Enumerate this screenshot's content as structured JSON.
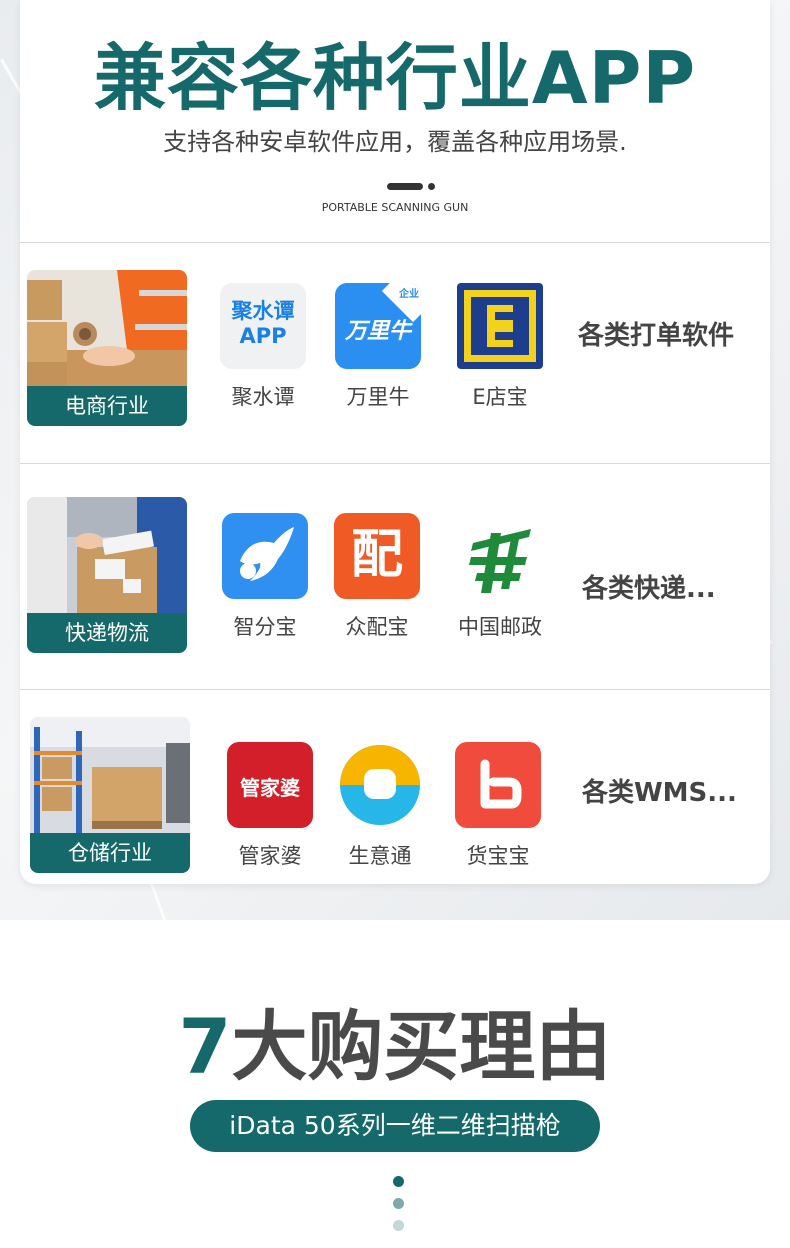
{
  "hero": {
    "title": "兼容各种行业APP",
    "subtitle": "支持各种安卓软件应用，覆盖各种应用场景.",
    "caption": "PORTABLE SCANNING GUN"
  },
  "rows": [
    {
      "industry": "电商行业",
      "apps": [
        {
          "name": "聚水谭",
          "icon": "jushuitan-app-icon",
          "icon_text": "聚水谭\nAPP"
        },
        {
          "name": "万里牛",
          "icon": "wanliniu-app-icon",
          "icon_text": "万里牛",
          "corner": "企业"
        },
        {
          "name": "E店宝",
          "icon": "edianbao-app-icon",
          "icon_text": "E"
        }
      ],
      "tag": "各类打单软件"
    },
    {
      "industry": "快递物流",
      "apps": [
        {
          "name": "智分宝",
          "icon": "zhifenbao-app-icon"
        },
        {
          "name": "众配宝",
          "icon": "zhongpeibao-app-icon",
          "icon_text": "配"
        },
        {
          "name": "中国邮政",
          "icon": "china-post-app-icon"
        }
      ],
      "tag": "各类快递..."
    },
    {
      "industry": "仓储行业",
      "apps": [
        {
          "name": "管家婆",
          "icon": "guanjiapo-app-icon",
          "icon_text": "管家婆"
        },
        {
          "name": "生意通",
          "icon": "shengyitong-app-icon"
        },
        {
          "name": "货宝宝",
          "icon": "huobaobao-app-icon",
          "icon_text": "b"
        }
      ],
      "tag": "各类WMS..."
    }
  ],
  "reasons": {
    "title_number": "7",
    "title_rest": "大购买理由",
    "pill": "iData 50系列一维二维扫描枪"
  },
  "colors": {
    "brand": "#16696a",
    "text_dark": "#444444",
    "wanliniu_blue": "#2a8ff0",
    "edianbao_blue": "#1c3e8c",
    "edianbao_yellow": "#f2d21a",
    "zhifenbao_blue": "#2f90f2",
    "zhongpeibao_orange": "#f05a24",
    "china_post_green": "#1e8a3a",
    "guanjiapo_red": "#d21f2a",
    "shengyitong_yellow": "#f7b500",
    "shengyitong_cyan": "#27b6e8",
    "huobaobao_red": "#f04b3c"
  }
}
